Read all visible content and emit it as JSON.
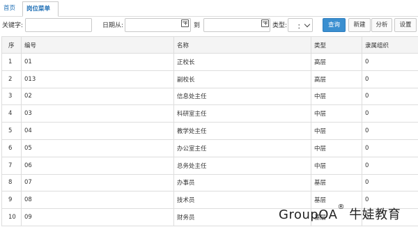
{
  "tabs": [
    {
      "label": "首页"
    },
    {
      "label": "岗位菜单",
      "close": "×"
    }
  ],
  "toolbar": {
    "keyword_label": "关键字:",
    "keyword_value": "",
    "date_from_label": "日期从:",
    "date_from_value": "",
    "date_to_label": "到",
    "date_to_value": "",
    "type_label": "类型:",
    "type_selected": "：",
    "query_button": "查询",
    "new_button": "新建",
    "analyze_button": "分析",
    "settings_button": "设置"
  },
  "table": {
    "columns": [
      "序",
      "编号",
      "名称",
      "类型",
      "隶属组织"
    ],
    "rows": [
      {
        "seq": "1",
        "code": "01",
        "name": "正校长",
        "type": "高层",
        "org": "0"
      },
      {
        "seq": "2",
        "code": "013",
        "name": "副校长",
        "type": "高层",
        "org": "0"
      },
      {
        "seq": "3",
        "code": "02",
        "name": "信息处主任",
        "type": "中层",
        "org": "0"
      },
      {
        "seq": "4",
        "code": "03",
        "name": "科研室主任",
        "type": "中层",
        "org": "0"
      },
      {
        "seq": "5",
        "code": "04",
        "name": "教学处主任",
        "type": "中层",
        "org": "0"
      },
      {
        "seq": "6",
        "code": "05",
        "name": "办公室主任",
        "type": "中层",
        "org": "0"
      },
      {
        "seq": "7",
        "code": "06",
        "name": "总务处主任",
        "type": "中层",
        "org": "0"
      },
      {
        "seq": "8",
        "code": "07",
        "name": "办事员",
        "type": "基层",
        "org": "0"
      },
      {
        "seq": "9",
        "code": "08",
        "name": "技术员",
        "type": "基层",
        "org": "0"
      },
      {
        "seq": "10",
        "code": "09",
        "name": "财务员",
        "type": "基层",
        "org": "0"
      }
    ]
  },
  "watermark": {
    "text": "GroupOA",
    "reg": "®",
    "suffix": " 牛娃教育"
  },
  "colors": {
    "accent": "#3a8fd0",
    "tab_text": "#1f6fb5",
    "border": "#dddddd"
  }
}
